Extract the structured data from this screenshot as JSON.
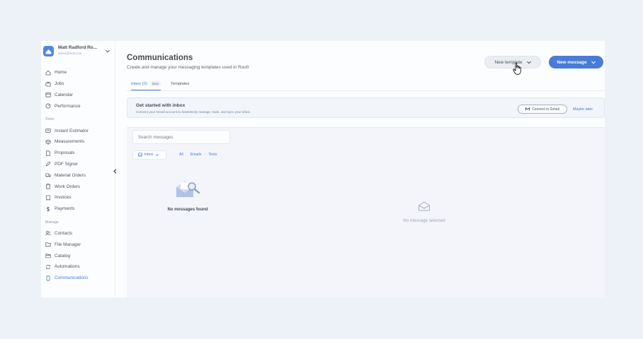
{
  "account": {
    "name": "Matt Radford Ro...",
    "email": "admin@roofr.com"
  },
  "nav": {
    "main": [
      {
        "label": "Home",
        "icon": "home-icon"
      },
      {
        "label": "Jobs",
        "icon": "briefcase-icon"
      },
      {
        "label": "Calendar",
        "icon": "calendar-icon"
      },
      {
        "label": "Performance",
        "icon": "gauge-icon"
      }
    ],
    "tools_label": "Tools",
    "tools": [
      {
        "label": "Instant Estimator",
        "icon": "house-estimate-icon"
      },
      {
        "label": "Measurements",
        "icon": "cube-icon"
      },
      {
        "label": "Proposals",
        "icon": "document-icon"
      },
      {
        "label": "PDF Signer",
        "icon": "pen-icon"
      },
      {
        "label": "Material Orders",
        "icon": "truck-icon"
      },
      {
        "label": "Work Orders",
        "icon": "clipboard-icon"
      },
      {
        "label": "Invoices",
        "icon": "receipt-icon"
      },
      {
        "label": "Payments",
        "icon": "dollar-icon"
      }
    ],
    "manage_label": "Manage",
    "manage": [
      {
        "label": "Contacts",
        "icon": "contacts-icon"
      },
      {
        "label": "File Manager",
        "icon": "folder-icon"
      },
      {
        "label": "Catalog",
        "icon": "catalog-icon"
      },
      {
        "label": "Automations",
        "icon": "automation-icon"
      },
      {
        "label": "Communications",
        "icon": "phone-icon",
        "active": true
      }
    ]
  },
  "header": {
    "title": "Communications",
    "subtitle": "Create and manage your messaging templates used in Roofr",
    "new_template_label": "New template",
    "new_message_label": "New message"
  },
  "tabs": {
    "inbox_label": "Inbox (0)",
    "inbox_badge": "Beta",
    "templates_label": "Templates"
  },
  "banner": {
    "title": "Get started with inbox",
    "subtitle": "Connect your Gmail account to seamlessly manage, track, and sync your inbox.",
    "connect_label": "Connect to Gmail",
    "later_label": "Maybe later"
  },
  "list": {
    "search_placeholder": "Search messages",
    "filter_inbox": "Inbox",
    "filter_all": "All",
    "filter_emails": "Emails",
    "filter_texts": "Texts",
    "empty_text": "No messages found"
  },
  "detail": {
    "empty_text": "No message selected"
  },
  "colors": {
    "accent": "#2562cf",
    "background": "#edf2f8"
  }
}
